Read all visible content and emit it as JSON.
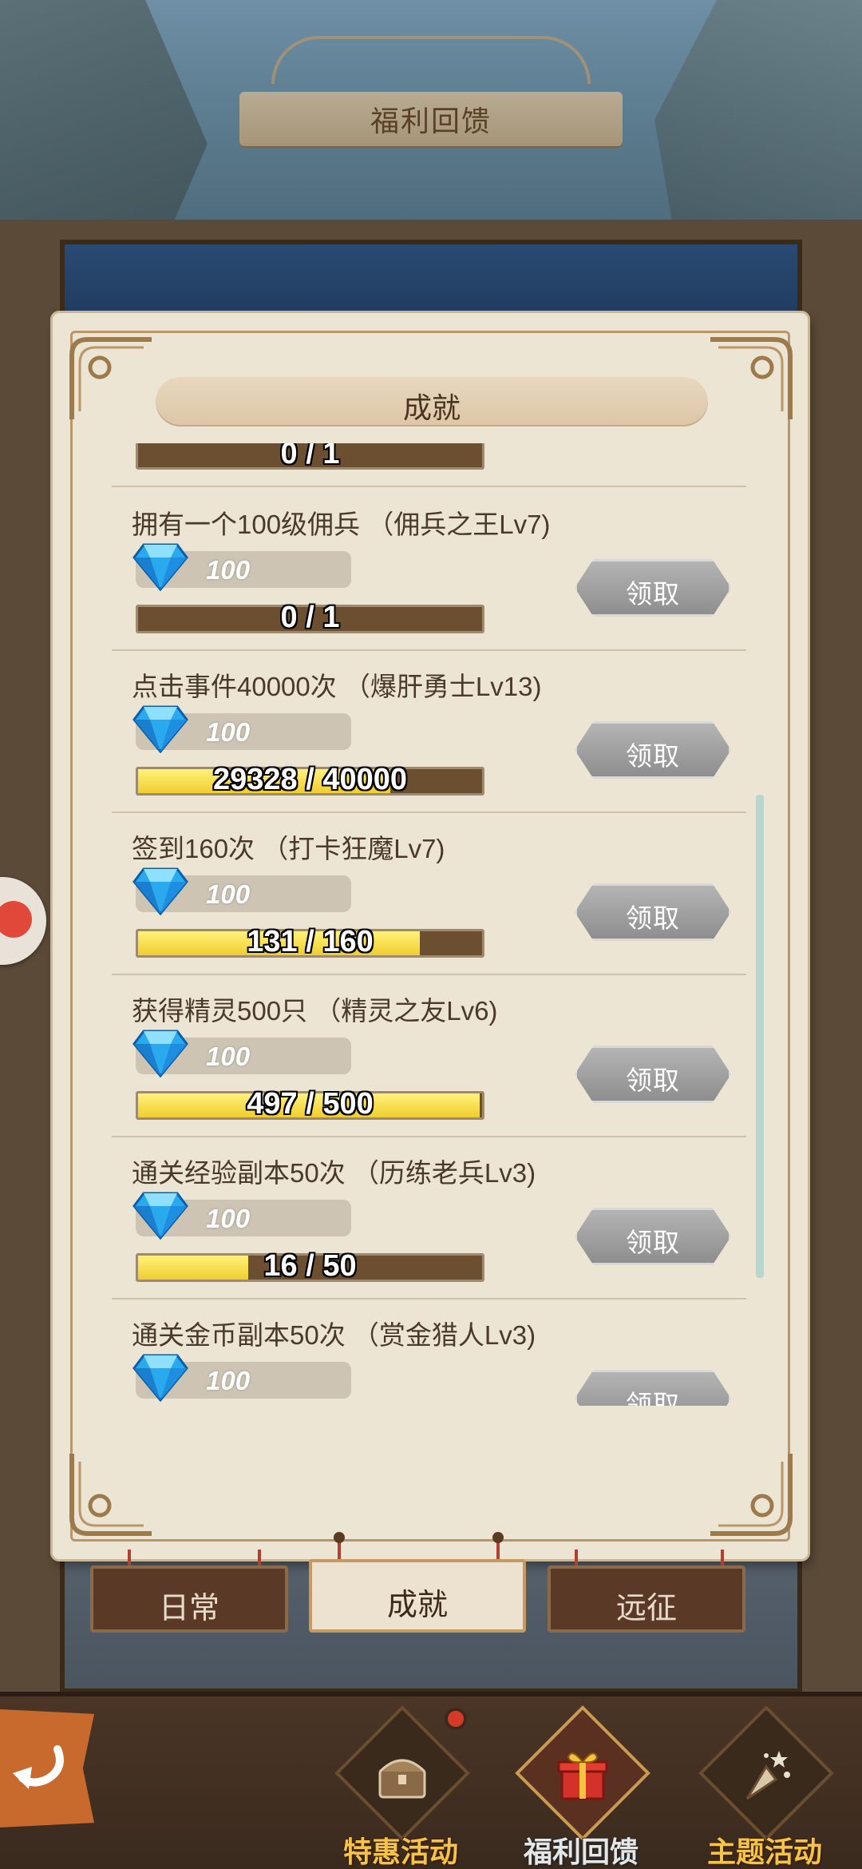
{
  "header": {
    "title": "福利回馈"
  },
  "panel": {
    "section_title": "成就"
  },
  "claim_label": "领取",
  "partial_top_row": {
    "progress_text": "0 / 1",
    "progress_fraction": 0.0
  },
  "achievements": [
    {
      "title": "拥有一个100级佣兵 （佣兵之王Lv7)",
      "reward": "100",
      "progress_text": "0 / 1",
      "progress_fraction": 0.0
    },
    {
      "title": "点击事件40000次 （爆肝勇士Lv13)",
      "reward": "100",
      "progress_text": "29328 / 40000",
      "progress_fraction": 0.733
    },
    {
      "title": "签到160次 （打卡狂魔Lv7)",
      "reward": "100",
      "progress_text": "131 / 160",
      "progress_fraction": 0.819
    },
    {
      "title": "获得精灵500只 （精灵之友Lv6)",
      "reward": "100",
      "progress_text": "497 / 500",
      "progress_fraction": 0.994
    },
    {
      "title": "通关经验副本50次 （历练老兵Lv3)",
      "reward": "100",
      "progress_text": "16 / 50",
      "progress_fraction": 0.32
    },
    {
      "title": "通关金币副本50次 （赏金猎人Lv3)",
      "reward": "100",
      "progress_text": "",
      "progress_fraction": 0.0
    }
  ],
  "subtabs": [
    {
      "label": "日常",
      "active": false
    },
    {
      "label": "成就",
      "active": true
    },
    {
      "label": "远征",
      "active": false
    }
  ],
  "bottom_nav": [
    {
      "label": "特惠活动",
      "icon": "treasure-chest-icon",
      "active": false
    },
    {
      "label": "福利回馈",
      "icon": "gift-box-icon",
      "active": true
    },
    {
      "label": "主题活动",
      "icon": "party-popper-icon",
      "active": false
    }
  ],
  "colors": {
    "progress_fill": "#f0cd2e",
    "progress_track": "#6b4f30",
    "claim_button": "#9e9e9e",
    "nav_label": "#f3c34a"
  }
}
